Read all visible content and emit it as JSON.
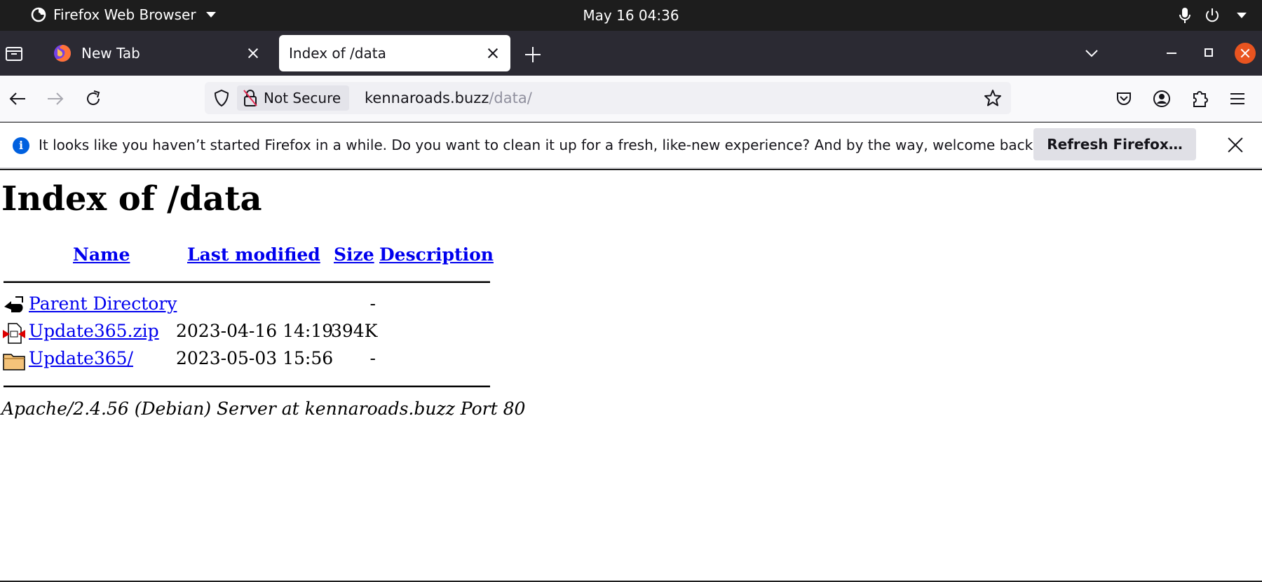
{
  "system": {
    "app_name": "Firefox Web Browser",
    "clock": "May 16  04:36"
  },
  "tabs": [
    {
      "title": "New Tab",
      "active": false
    },
    {
      "title": "Index of /data",
      "active": true
    }
  ],
  "navbar": {
    "security_label": "Not Secure",
    "url_host": "kennaroads.buzz",
    "url_path": "/data/"
  },
  "notification": {
    "message": "It looks like you haven’t started Firefox in a while. Do you want to clean it up for a fresh, like-new experience? And by the way, welcome back!",
    "button_label": "Refresh Firefox…"
  },
  "page": {
    "heading": "Index of /data",
    "columns": [
      "Name",
      "Last modified",
      "Size",
      "Description"
    ],
    "rows": [
      {
        "icon": "back-icon",
        "name": "Parent Directory",
        "modified": "",
        "size": "-"
      },
      {
        "icon": "compressed-file-icon",
        "name": "Update365.zip",
        "modified": "2023-04-16 14:19",
        "size": "394K"
      },
      {
        "icon": "folder-icon",
        "name": "Update365/",
        "modified": "2023-05-03 15:56",
        "size": "-"
      }
    ],
    "footer": "Apache/2.4.56 (Debian) Server at kennaroads.buzz Port 80"
  },
  "colors": {
    "link": "#0000ee",
    "accent_close": "#e95420",
    "info_blue": "#0060df"
  }
}
